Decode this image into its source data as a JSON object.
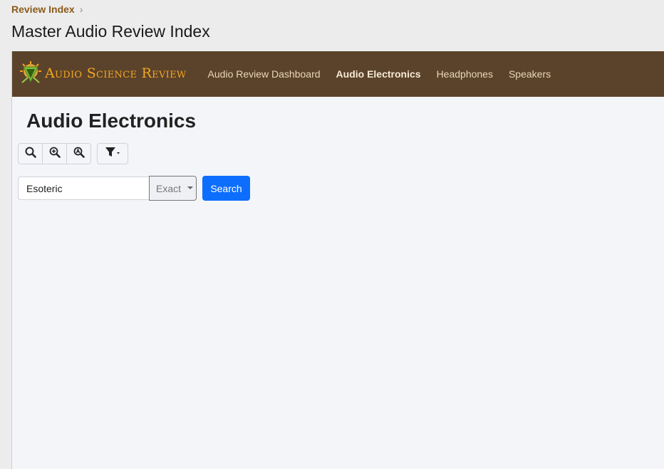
{
  "breadcrumb": {
    "item": "Review Index",
    "separator": "›"
  },
  "page": {
    "title": "Master Audio Review Index"
  },
  "navbar": {
    "brand": "Audio Science Review",
    "links": [
      {
        "label": "Audio Review Dashboard",
        "active": false
      },
      {
        "label": "Audio Electronics",
        "active": true
      },
      {
        "label": "Headphones",
        "active": false
      },
      {
        "label": "Speakers",
        "active": false
      }
    ],
    "background": "#5b432b",
    "brand_color": "#f4a623"
  },
  "main": {
    "heading": "Audio Electronics",
    "toolbar": {
      "icons": [
        "search-icon",
        "zoom-in-icon",
        "zoom-auto-icon"
      ],
      "filter_icon": "filter-icon"
    },
    "search": {
      "value": "Esoteric",
      "mode": "Exact",
      "button_label": "Search",
      "button_color": "#0d6efd"
    }
  }
}
